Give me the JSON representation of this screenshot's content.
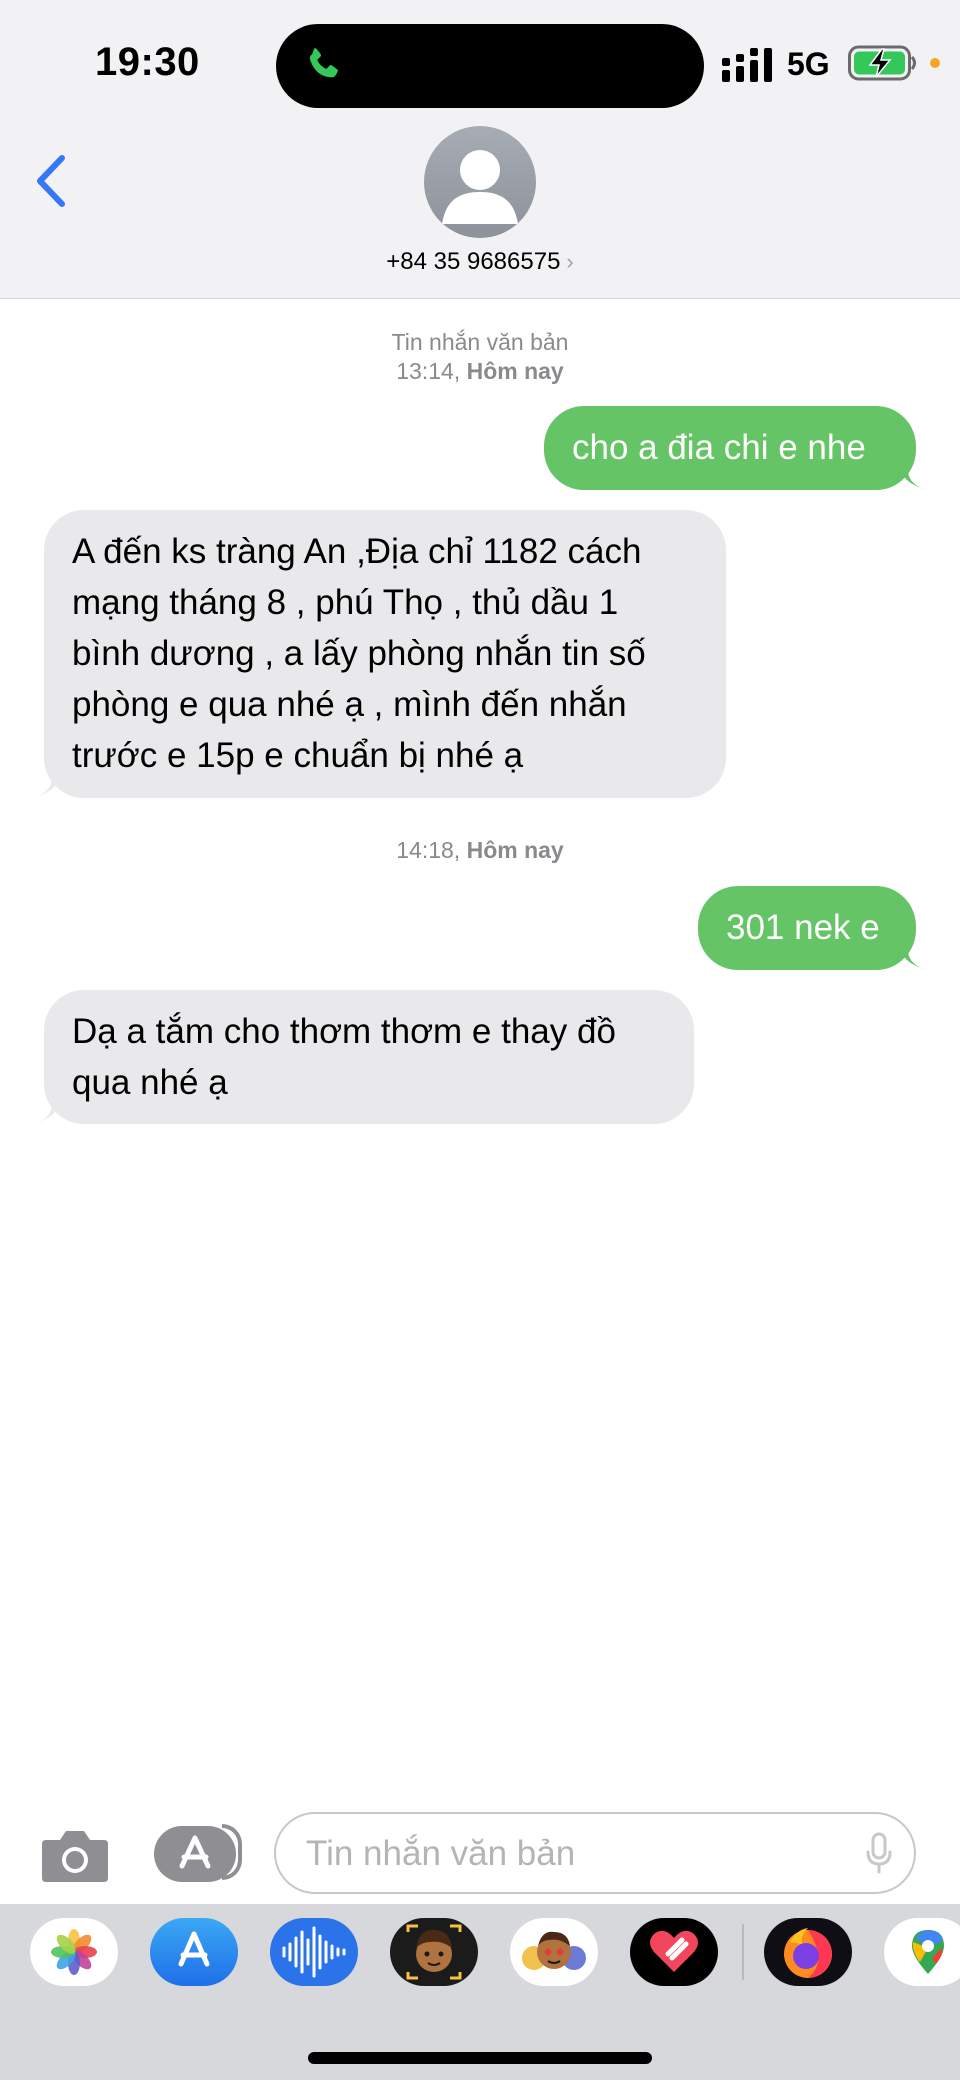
{
  "status_bar": {
    "time": "19:30",
    "network": "5G"
  },
  "header": {
    "contact": "+84 35 9686575",
    "chevron": "›"
  },
  "thread": [
    {
      "kind": "meta",
      "line1": "Tin nhắn văn bản",
      "line2_time": "13:14,",
      "line2_day": "Hôm nay"
    },
    {
      "kind": "outgoing",
      "text": "cho a đia chi e nhe"
    },
    {
      "kind": "incoming",
      "lines": [
        "A đến ks tràng An ,Địa chỉ 1182 cách",
        "mạng tháng 8 , phú Thọ , thủ dầu 1",
        "bình dương , a lấy phòng nhắn tin số",
        "phòng e qua nhé ạ , mình đến nhắn",
        "trước e 15p e chuẩn bị nhé ạ"
      ]
    },
    {
      "kind": "meta",
      "line2_time": "14:18,",
      "line2_day": "Hôm nay"
    },
    {
      "kind": "outgoing",
      "text": "301 nek e"
    },
    {
      "kind": "incoming",
      "lines": [
        "Dạ a tắm cho thơm thơm e thay đồ",
        "qua nhé ạ"
      ]
    }
  ],
  "composer": {
    "placeholder": "Tin nhắn văn bản"
  },
  "drawer_apps": [
    "photos-app",
    "app-store-app",
    "audio-message-app",
    "memoji-app",
    "animoji-stickers-app",
    "digital-touch-app",
    "firefox-app",
    "maps-app"
  ],
  "colors": {
    "outgoing_bubble": "#65c466",
    "incoming_bubble": "#e9e9eb",
    "ios_blue": "#3478f6"
  }
}
